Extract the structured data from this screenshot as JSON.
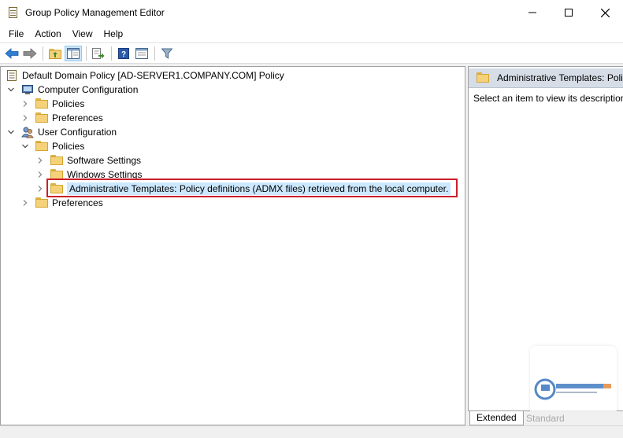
{
  "window": {
    "title": "Group Policy Management Editor",
    "minimize_icon": "minimize-icon",
    "maximize_icon": "maximize-icon",
    "close_icon": "close-icon"
  },
  "menu": [
    "File",
    "Action",
    "View",
    "Help"
  ],
  "toolbar": {
    "icons": [
      "back-arrow-icon",
      "forward-arrow-icon",
      "up-folder-icon",
      "show-hide-tree-icon",
      "export-list-icon",
      "help-icon",
      "properties-icon",
      "filter-icon"
    ]
  },
  "tree": {
    "root": "Default Domain Policy [AD-SERVER1.COMPANY.COM] Policy",
    "computer_config": "Computer Configuration",
    "cc_policies": "Policies",
    "cc_preferences": "Preferences",
    "user_config": "User Configuration",
    "uc_policies": "Policies",
    "software_settings": "Software Settings",
    "windows_settings": "Windows Settings",
    "admin_templates": "Administrative Templates: Policy definitions (ADMX files) retrieved from the local computer.",
    "uc_preferences": "Preferences"
  },
  "right_pane": {
    "header": "Administrative Templates: Poli",
    "description": "Select an item to view its description"
  },
  "tabs": {
    "extended": "Extended",
    "standard": "Standard"
  },
  "colors": {
    "highlight_border": "#cc1f2a",
    "selection": "#cce8ff",
    "header_bg": "#d6dde7"
  }
}
